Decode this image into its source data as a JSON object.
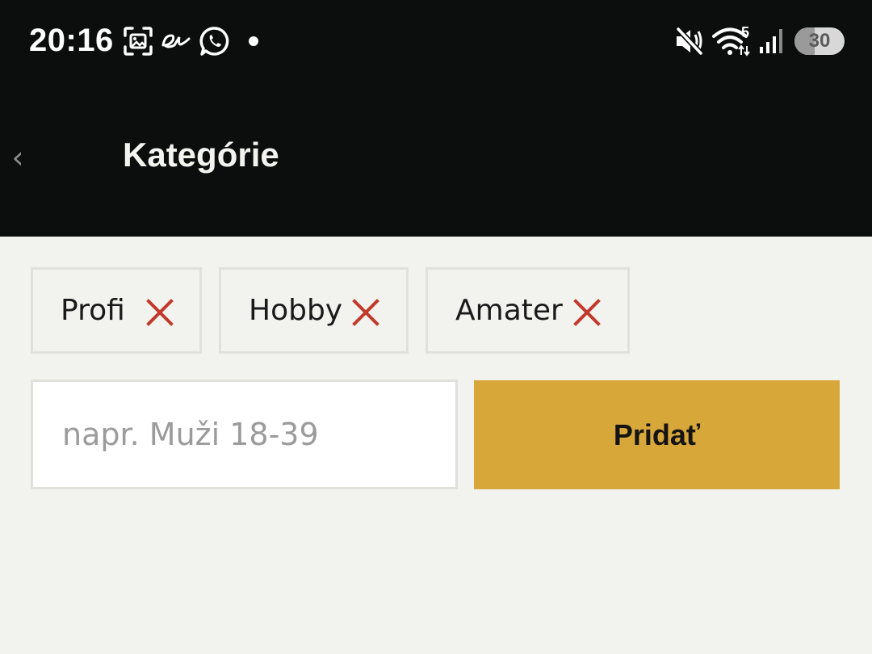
{
  "status_bar": {
    "time": "20:16",
    "notification_icons": [
      "screenshot-icon",
      "aliexpress-icon",
      "whatsapp-icon",
      "dot-icon"
    ],
    "system_icons": [
      "mute-icon",
      "wifi-icon",
      "signal-icon"
    ],
    "wifi_label": "5",
    "battery": "30"
  },
  "header": {
    "back_icon": "chevron-left-icon",
    "back_glyph": "‹",
    "title": "Kategórie"
  },
  "categories": [
    {
      "label": "Profi"
    },
    {
      "label": "Hobby"
    },
    {
      "label": "Amater"
    }
  ],
  "form": {
    "input_value": "",
    "input_placeholder": "napr. Muži 18-39",
    "add_label": "Pridať"
  },
  "colors": {
    "header_bg": "#0c0d0d",
    "page_bg": "#f2f2ee",
    "accent": "#d8a73a",
    "remove_red": "#c0392b"
  }
}
